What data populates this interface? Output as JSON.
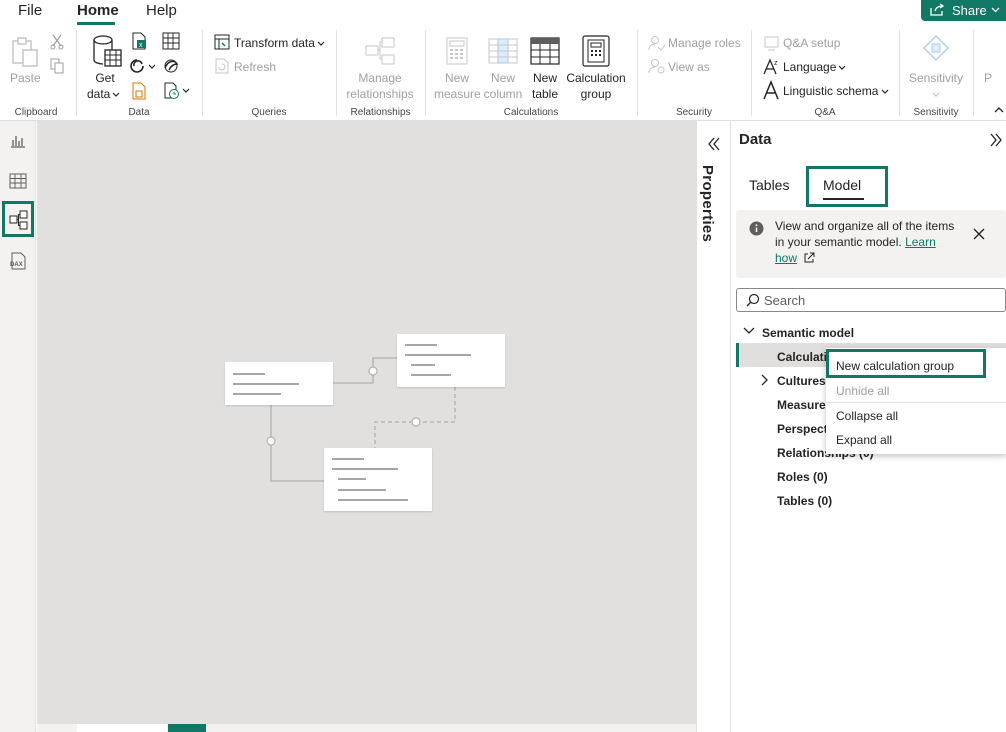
{
  "menubar": {
    "file": "File",
    "home": "Home",
    "help": "Help",
    "share": "Share"
  },
  "ribbon": {
    "clipboard": {
      "paste": "Paste",
      "label": "Clipboard"
    },
    "data": {
      "get_data_1": "Get",
      "get_data_2": "data",
      "label": "Data"
    },
    "queries": {
      "transform": "Transform data",
      "refresh": "Refresh",
      "label": "Queries"
    },
    "relationships": {
      "manage_1": "Manage",
      "manage_2": "relationships",
      "label": "Relationships"
    },
    "calculations": {
      "new_measure_1": "New",
      "new_measure_2": "measure",
      "new_column_1": "New",
      "new_column_2": "column",
      "new_table_1": "New",
      "new_table_2": "table",
      "calc_group_1": "Calculation",
      "calc_group_2": "group",
      "label": "Calculations"
    },
    "security": {
      "manage_roles": "Manage roles",
      "view_as": "View as",
      "label": "Security"
    },
    "qa": {
      "qa_setup": "Q&A setup",
      "language": "Language",
      "linguistic": "Linguistic schema",
      "label": "Q&A"
    },
    "sensitivity": {
      "sensitivity": "Sensitivity",
      "label": "Sensitivity",
      "extra": "P"
    }
  },
  "properties": {
    "label": "Properties"
  },
  "datapane": {
    "title": "Data",
    "tabs": {
      "tables": "Tables",
      "model": "Model"
    },
    "info": {
      "text": "View and organize all of the items in your semantic model. ",
      "link1": "Learn",
      "link2": "how"
    },
    "search": {
      "placeholder": "Search"
    },
    "tree": {
      "root": "Semantic model",
      "calc": "Calculation groups (0)",
      "cultures": "Cultures (1)",
      "measures": "Measures (0)",
      "perspectives": "Perspectives (0)",
      "relationships": "Relationships (0)",
      "roles": "Roles (0)",
      "tables": "Tables (0)"
    }
  },
  "context_menu": {
    "new_calc_group": "New calculation group",
    "unhide_all": "Unhide all",
    "collapse_all": "Collapse all",
    "expand_all": "Expand all"
  },
  "colors": {
    "accent": "#117865",
    "canvas": "#e1e0df"
  }
}
